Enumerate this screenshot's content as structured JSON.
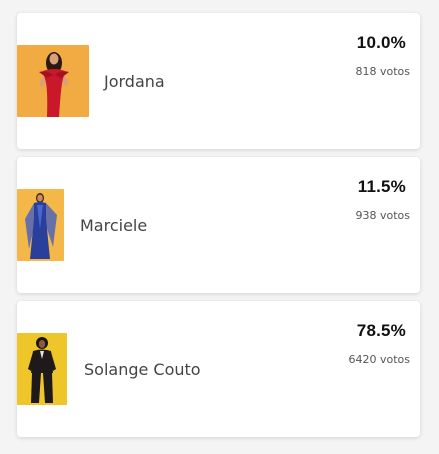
{
  "candidates": [
    {
      "name": "Jordana",
      "percent": "10.0%",
      "votes": "818 votos",
      "photo_bg": "#f0a53a",
      "outfit_color": "#c8182a"
    },
    {
      "name": "Marciele",
      "percent": "11.5%",
      "votes": "938 votos",
      "photo_bg": "#f2b23c",
      "outfit_color": "#2a3f9c"
    },
    {
      "name": "Solange Couto",
      "percent": "78.5%",
      "votes": "6420 votos",
      "photo_bg": "#ecc11e",
      "outfit_color": "#1e1a1c"
    }
  ]
}
